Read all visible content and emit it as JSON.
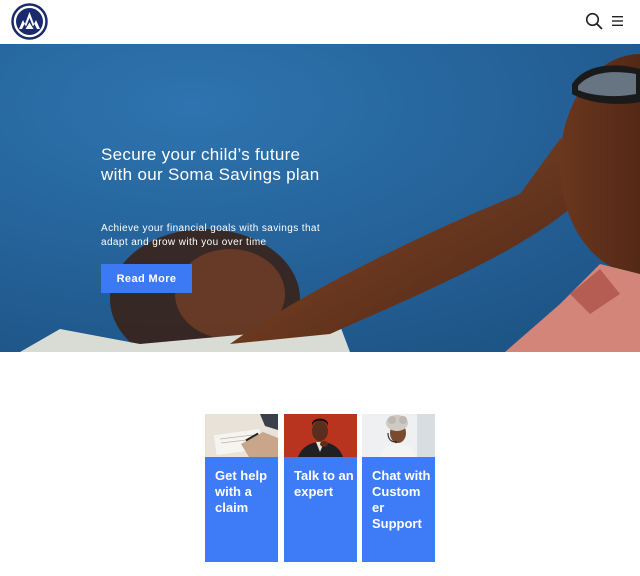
{
  "header": {
    "logo": "shield-flame-logo",
    "icons": [
      "search-icon",
      "hamburger-menu-icon"
    ]
  },
  "hero": {
    "title": "Secure your child’s future with our Soma Savings plan",
    "subtitle": "Achieve your financial goals with savings that adapt and grow with you over time",
    "cta_label": "Read More"
  },
  "cards": [
    {
      "label": "Get help with a claim"
    },
    {
      "label": "Talk to an expert"
    },
    {
      "label": "Chat with Custom er Support"
    }
  ],
  "colors": {
    "accent": "#3b79f5",
    "card": "#3e7bf6",
    "logo_navy": "#1a2a6c",
    "hero_sky": "#2a6aa0"
  }
}
